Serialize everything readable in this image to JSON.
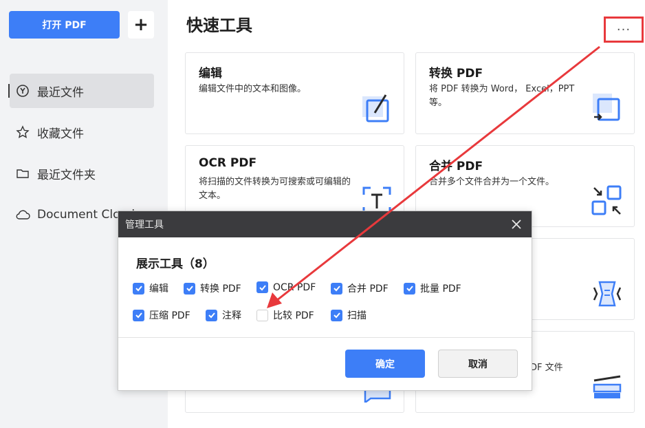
{
  "sidebar": {
    "open_pdf": "打开 PDF",
    "add": "+",
    "items": [
      {
        "label": "最近文件",
        "icon": "recent-icon"
      },
      {
        "label": "收藏文件",
        "icon": "star-icon"
      },
      {
        "label": "最近文件夹",
        "icon": "folder-icon"
      },
      {
        "label": "Document Cloud",
        "icon": "cloud-icon"
      }
    ]
  },
  "main": {
    "title": "快速工具",
    "more": "···",
    "cards": [
      {
        "title": "编辑",
        "desc": "编辑文件中的文本和图像。",
        "icon": "edit-icon"
      },
      {
        "title": "转换 PDF",
        "desc": "将 PDF 转换为 Word， Excel，PPT等。",
        "icon": "convert-icon"
      },
      {
        "title": "OCR PDF",
        "desc": "将扫描的文件转换为可搜索或可编辑的文本。",
        "icon": "ocr-icon"
      },
      {
        "title": "合并 PDF",
        "desc": "合并多个文件合并为一个文件。",
        "icon": "merge-icon"
      },
      {
        "title": "",
        "desc": "",
        "icon": "compress-icon"
      },
      {
        "title": "",
        "desc": "DF 文件",
        "icon": "scan-icon"
      },
      {
        "title": "",
        "desc": "",
        "icon": "comment-icon"
      }
    ]
  },
  "dialog": {
    "title": "管理工具",
    "subtitle": "展示工具（8）",
    "options": [
      {
        "label": "编辑",
        "checked": true
      },
      {
        "label": "转换 PDF",
        "checked": true
      },
      {
        "label": "OCR PDF",
        "checked": true
      },
      {
        "label": "合并 PDF",
        "checked": true
      },
      {
        "label": "批量 PDF",
        "checked": true
      },
      {
        "label": "压缩 PDF",
        "checked": true
      },
      {
        "label": "注释",
        "checked": true
      },
      {
        "label": "比较 PDF",
        "checked": false
      },
      {
        "label": "扫描",
        "checked": true
      }
    ],
    "ok": "确定",
    "cancel": "取消"
  },
  "colors": {
    "accent": "#3d7ef7",
    "highlight": "#e8393c",
    "dialog_header": "#3b3b3e"
  }
}
